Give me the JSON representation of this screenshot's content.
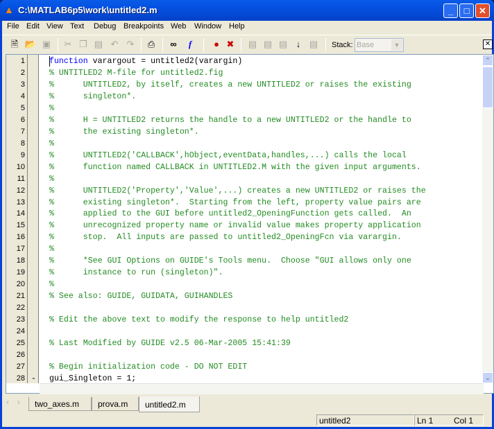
{
  "window": {
    "title": "C:\\MATLAB6p5\\work\\untitled2.m",
    "accent": "#0450e0"
  },
  "menu": [
    "File",
    "Edit",
    "View",
    "Text",
    "Debug",
    "Breakpoints",
    "Web",
    "Window",
    "Help"
  ],
  "toolbar": {
    "stack_label": "Stack:",
    "stack_value": "Base",
    "icons": [
      "new-file",
      "open",
      "save",
      "cut",
      "copy",
      "paste",
      "undo",
      "redo",
      "print",
      "find",
      "function",
      "set-breakpoint",
      "clear-breakpoints",
      "step",
      "step-in",
      "step-out",
      "continue",
      "exit-debug"
    ]
  },
  "editor": {
    "lines": [
      {
        "n": "1",
        "parts": [
          {
            "t": "function",
            "k": "kw"
          },
          {
            "t": " varargout = untitled2(varargin)",
            "k": ""
          }
        ]
      },
      {
        "n": "2",
        "parts": [
          {
            "t": "% UNTITLED2 M-file for untitled2.fig",
            "k": "cm"
          }
        ]
      },
      {
        "n": "3",
        "parts": [
          {
            "t": "%      UNTITLED2, by itself, creates a new UNTITLED2 or raises the existing",
            "k": "cm"
          }
        ]
      },
      {
        "n": "4",
        "parts": [
          {
            "t": "%      singleton*.",
            "k": "cm"
          }
        ]
      },
      {
        "n": "5",
        "parts": [
          {
            "t": "%",
            "k": "cm"
          }
        ]
      },
      {
        "n": "6",
        "parts": [
          {
            "t": "%      H = UNTITLED2 returns the handle to a new UNTITLED2 or the handle to",
            "k": "cm"
          }
        ]
      },
      {
        "n": "7",
        "parts": [
          {
            "t": "%      the existing singleton*.",
            "k": "cm"
          }
        ]
      },
      {
        "n": "8",
        "parts": [
          {
            "t": "%",
            "k": "cm"
          }
        ]
      },
      {
        "n": "9",
        "parts": [
          {
            "t": "%      UNTITLED2('CALLBACK',hObject,eventData,handles,...) calls the local",
            "k": "cm"
          }
        ]
      },
      {
        "n": "10",
        "parts": [
          {
            "t": "%      function named CALLBACK in UNTITLED2.M with the given input arguments.",
            "k": "cm"
          }
        ]
      },
      {
        "n": "11",
        "parts": [
          {
            "t": "%",
            "k": "cm"
          }
        ]
      },
      {
        "n": "12",
        "parts": [
          {
            "t": "%      UNTITLED2('Property','Value',...) creates a new UNTITLED2 or raises the",
            "k": "cm"
          }
        ]
      },
      {
        "n": "13",
        "parts": [
          {
            "t": "%      existing singleton*.  Starting from the left, property value pairs are",
            "k": "cm"
          }
        ]
      },
      {
        "n": "14",
        "parts": [
          {
            "t": "%      applied to the GUI before untitled2_OpeningFunction gets called.  An",
            "k": "cm"
          }
        ]
      },
      {
        "n": "15",
        "parts": [
          {
            "t": "%      unrecognized property name or invalid value makes property application",
            "k": "cm"
          }
        ]
      },
      {
        "n": "16",
        "parts": [
          {
            "t": "%      stop.  All inputs are passed to untitled2_OpeningFcn via varargin.",
            "k": "cm"
          }
        ]
      },
      {
        "n": "17",
        "parts": [
          {
            "t": "%",
            "k": "cm"
          }
        ]
      },
      {
        "n": "18",
        "parts": [
          {
            "t": "%      *See GUI Options on GUIDE's Tools menu.  Choose \"GUI allows only one",
            "k": "cm"
          }
        ]
      },
      {
        "n": "19",
        "parts": [
          {
            "t": "%      instance to run (singleton)\".",
            "k": "cm"
          }
        ]
      },
      {
        "n": "20",
        "parts": [
          {
            "t": "%",
            "k": "cm"
          }
        ]
      },
      {
        "n": "21",
        "parts": [
          {
            "t": "% See also: GUIDE, GUIDATA, GUIHANDLES",
            "k": "cm"
          }
        ]
      },
      {
        "n": "22",
        "parts": []
      },
      {
        "n": "23",
        "parts": [
          {
            "t": "% Edit the above text to modify the response to help untitled2",
            "k": "cm"
          }
        ]
      },
      {
        "n": "24",
        "parts": []
      },
      {
        "n": "25",
        "parts": [
          {
            "t": "% Last Modified by GUIDE v2.5 06-Mar-2005 15:41:39",
            "k": "cm"
          }
        ]
      },
      {
        "n": "26",
        "parts": []
      },
      {
        "n": "27",
        "parts": [
          {
            "t": "% Begin initialization code - DO NOT EDIT",
            "k": "cm"
          }
        ]
      },
      {
        "n": "28",
        "bp": "-",
        "parts": [
          {
            "t": "gui_Singleton = 1;",
            "k": ""
          }
        ]
      }
    ]
  },
  "tabs": [
    {
      "label": "two_axes.m"
    },
    {
      "label": "prova.m"
    },
    {
      "label": "untitled2.m",
      "active": true
    }
  ],
  "status": {
    "function": "untitled2",
    "line": "Ln 1",
    "col": "Col 1"
  }
}
